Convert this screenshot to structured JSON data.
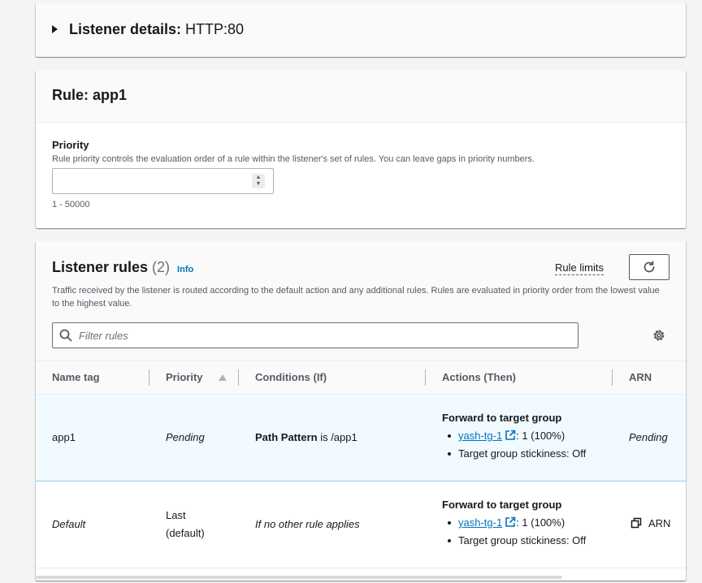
{
  "listener_details": {
    "label": "Listener details:",
    "value": "HTTP:80"
  },
  "rule": {
    "title": "Rule: app1",
    "priority": {
      "label": "Priority",
      "description": "Rule priority controls the evaluation order of a rule within the listener's set of rules. You can leave gaps in priority numbers.",
      "value": "",
      "constraint": "1 - 50000"
    }
  },
  "listener_rules": {
    "title": "Listener rules",
    "count": "(2)",
    "info_label": "Info",
    "rule_limits_label": "Rule limits",
    "description": "Traffic received by the listener is routed according to the default action and any additional rules. Rules are evaluated in priority order from the lowest value to the highest value.",
    "filter_placeholder": "Filter rules",
    "columns": [
      "Name tag",
      "Priority",
      "Conditions (If)",
      "Actions (Then)",
      "ARN"
    ],
    "rows": [
      {
        "name_tag": "app1",
        "priority": "Pending",
        "condition_bold": "Path Pattern",
        "condition_rest": " is /app1",
        "action_title": "Forward to target group",
        "target_group": "yash-tg-1",
        "target_weight": ": 1 (100%)",
        "stickiness": "Target group stickiness: Off",
        "arn": "Pending"
      },
      {
        "name_tag": "Default",
        "priority": "Last (default)",
        "condition": "If no other rule applies",
        "action_title": "Forward to target group",
        "target_group": "yash-tg-1",
        "target_weight": ": 1 (100%)",
        "stickiness": "Target group stickiness: Off",
        "arn": "ARN"
      }
    ]
  },
  "colors": {
    "link": "#0073bb",
    "selected_row_bg": "#f1faff",
    "selected_row_border": "#99cbe4",
    "text": "#16191f",
    "muted_text": "#545b64"
  },
  "icons": [
    "caret-right-icon",
    "stepper-icon",
    "refresh-icon",
    "search-icon",
    "settings-gear-icon",
    "sort-ascending-icon",
    "external-link-icon",
    "copy-icon"
  ]
}
